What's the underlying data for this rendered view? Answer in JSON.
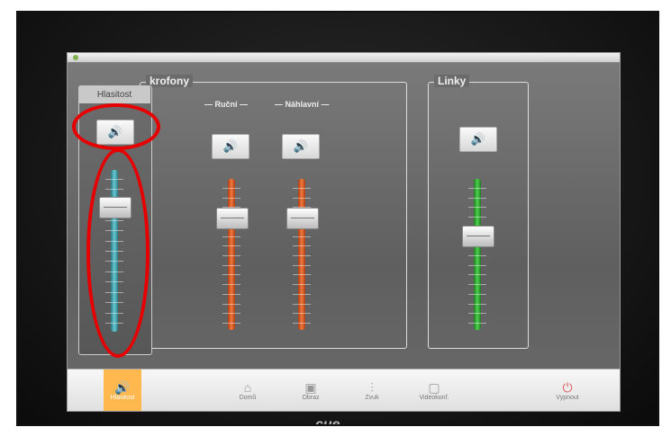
{
  "volume_tab": {
    "title": "Hlasitost"
  },
  "groups": {
    "mikrofony": {
      "title": "krofony",
      "channels": [
        {
          "label": "— Ruční —"
        },
        {
          "label": "— Náhlavní —"
        }
      ]
    },
    "linky": {
      "title": "Linky"
    }
  },
  "bottom_nav": [
    {
      "label": "Hlasitost",
      "icon": "speaker-icon"
    },
    {
      "label": "Domů",
      "icon": "home-icon"
    },
    {
      "label": "Obraz",
      "icon": "screen-icon"
    },
    {
      "label": "Zvuk",
      "icon": "equalizer-icon"
    },
    {
      "label": "Videokonf.",
      "icon": "videoconf-icon"
    },
    {
      "label": "Vypnout",
      "icon": "power-icon"
    }
  ],
  "brand": "cue",
  "levels": {
    "master": 0.78,
    "rucni": 0.72,
    "nahlavni": 0.72,
    "linky": 0.65
  },
  "colors": {
    "mic_track": "#f07a3c",
    "line_track": "#4fd24f",
    "master_track": "#6cc6cf",
    "active_nav": "#ffb84d",
    "highlight": "#e60000"
  }
}
